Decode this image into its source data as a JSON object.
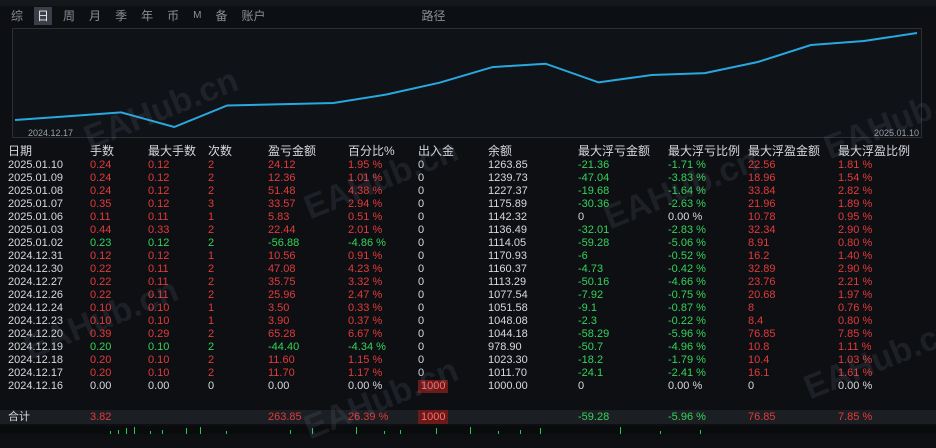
{
  "tabs": [
    "综",
    "日",
    "周",
    "月",
    "季",
    "年",
    "币",
    "M",
    "备",
    "账户",
    "路径"
  ],
  "active_tab": "日",
  "chart": {
    "start_label": "2024.12.17",
    "end_label": "2025.01.10",
    "line_color": "#29a8e0",
    "balance_series": [
      1000.0,
      1011.7,
      1023.3,
      978.9,
      1044.18,
      1048.08,
      1051.58,
      1077.54,
      1113.29,
      1160.37,
      1170.93,
      1114.05,
      1136.49,
      1142.32,
      1175.89,
      1227.37,
      1239.73,
      1263.85
    ]
  },
  "headers": [
    "日期",
    "手数",
    "最大手数",
    "次数",
    "盈亏金额",
    "百分比%",
    "出入金",
    "余额",
    "最大浮亏金额",
    "最大浮亏比例",
    "最大浮盈金额",
    "最大浮盈比例"
  ],
  "rows": [
    [
      "2025.01.10",
      "0.24",
      "0.12",
      "2",
      "24.12",
      "1.95 %",
      "0",
      "1263.85",
      "-21.36",
      "-1.71 %",
      "22.56",
      "1.81 %"
    ],
    [
      "2025.01.09",
      "0.24",
      "0.12",
      "2",
      "12.36",
      "1.01 %",
      "0",
      "1239.73",
      "-47.04",
      "-3.83 %",
      "18.96",
      "1.54 %"
    ],
    [
      "2025.01.08",
      "0.24",
      "0.12",
      "2",
      "51.48",
      "4.38 %",
      "0",
      "1227.37",
      "-19.68",
      "-1.64 %",
      "33.84",
      "2.82 %"
    ],
    [
      "2025.01.07",
      "0.35",
      "0.12",
      "3",
      "33.57",
      "2.94 %",
      "0",
      "1175.89",
      "-30.36",
      "-2.63 %",
      "21.96",
      "1.89 %"
    ],
    [
      "2025.01.06",
      "0.11",
      "0.11",
      "1",
      "5.83",
      "0.51 %",
      "0",
      "1142.32",
      "0",
      "0.00 %",
      "10.78",
      "0.95 %"
    ],
    [
      "2025.01.03",
      "0.44",
      "0.33",
      "2",
      "22.44",
      "2.01 %",
      "0",
      "1136.49",
      "-32.01",
      "-2.83 %",
      "32.34",
      "2.90 %"
    ],
    [
      "2025.01.02",
      "0.23",
      "0.12",
      "2",
      "-56.88",
      "-4.86 %",
      "0",
      "1114.05",
      "-59.28",
      "-5.06 %",
      "8.91",
      "0.80 %"
    ],
    [
      "2024.12.31",
      "0.12",
      "0.12",
      "1",
      "10.56",
      "0.91 %",
      "0",
      "1170.93",
      "-6",
      "-0.52 %",
      "16.2",
      "1.40 %"
    ],
    [
      "2024.12.30",
      "0.22",
      "0.11",
      "2",
      "47.08",
      "4.23 %",
      "0",
      "1160.37",
      "-4.73",
      "-0.42 %",
      "32.89",
      "2.90 %"
    ],
    [
      "2024.12.27",
      "0.22",
      "0.11",
      "2",
      "35.75",
      "3.32 %",
      "0",
      "1113.29",
      "-50.16",
      "-4.66 %",
      "23.76",
      "2.21 %"
    ],
    [
      "2024.12.26",
      "0.22",
      "0.11",
      "2",
      "25.96",
      "2.47 %",
      "0",
      "1077.54",
      "-7.92",
      "-0.75 %",
      "20.68",
      "1.97 %"
    ],
    [
      "2024.12.24",
      "0.10",
      "0.10",
      "1",
      "3.50",
      "0.33 %",
      "0",
      "1051.58",
      "-9.1",
      "-0.87 %",
      "8",
      "0.76 %"
    ],
    [
      "2024.12.23",
      "0.10",
      "0.10",
      "1",
      "3.90",
      "0.37 %",
      "0",
      "1048.08",
      "-2.3",
      "-0.22 %",
      "8.4",
      "0.80 %"
    ],
    [
      "2024.12.20",
      "0.39",
      "0.29",
      "2",
      "65.28",
      "6.67 %",
      "0",
      "1044.18",
      "-58.29",
      "-5.96 %",
      "76.85",
      "7.85 %"
    ],
    [
      "2024.12.19",
      "0.20",
      "0.10",
      "2",
      "-44.40",
      "-4.34 %",
      "0",
      "978.90",
      "-50.7",
      "-4.96 %",
      "10.8",
      "1.11 %"
    ],
    [
      "2024.12.18",
      "0.20",
      "0.10",
      "2",
      "11.60",
      "1.15 %",
      "0",
      "1023.30",
      "-18.2",
      "-1.79 %",
      "10.4",
      "1.03 %"
    ],
    [
      "2024.12.17",
      "0.20",
      "0.10",
      "2",
      "11.70",
      "1.17 %",
      "0",
      "1011.70",
      "-24.1",
      "-2.41 %",
      "16.1",
      "1.61 %"
    ],
    [
      "2024.12.16",
      "0.00",
      "0.00",
      "0",
      "0.00",
      "0.00 %",
      "1000",
      "1000.00",
      "0",
      "0.00 %",
      "0",
      "0.00 %"
    ]
  ],
  "total": [
    "合计",
    "3.82",
    "",
    "",
    "263.85",
    "26.39 %",
    "1000",
    "",
    "-59.28",
    "-5.96 %",
    "76.85",
    "7.85 %"
  ],
  "watermark": "EAHub.cn",
  "colors": {
    "profit": "#e23b3b",
    "loss": "#35d35a",
    "neutral": "#d6d9de",
    "deposit": "#6b1a1a"
  }
}
